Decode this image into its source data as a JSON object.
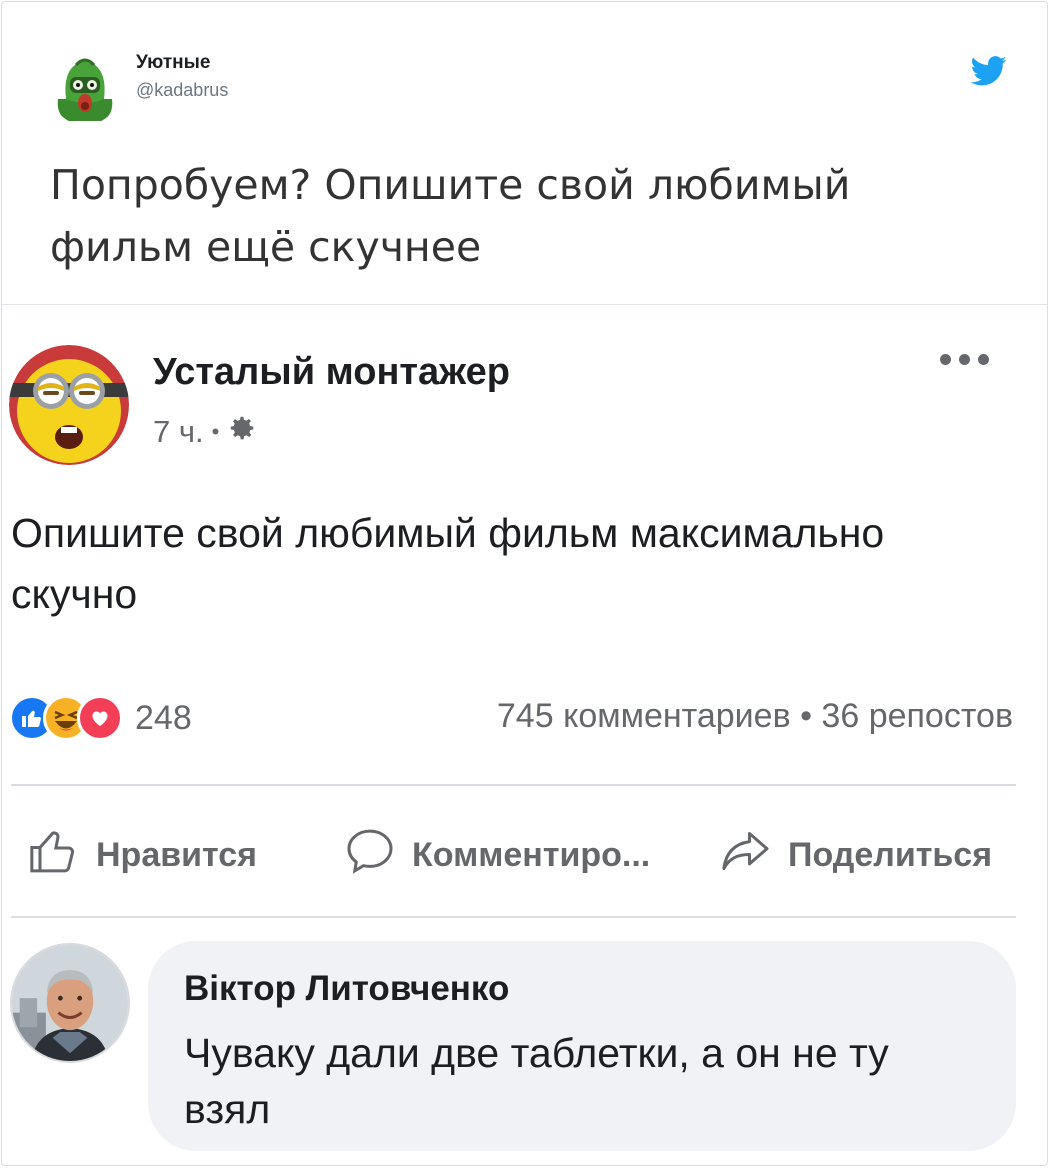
{
  "tweet": {
    "author_name": "Уютные",
    "author_handle": "@kadabrus",
    "text": "Попробуем? Опишите свой любимый фильм ещё скучнее",
    "icons": {
      "avatar": "avatar-character",
      "platform": "twitter-bird-icon"
    },
    "colors": {
      "bird": "#1da1f2",
      "text": "#333333",
      "handle": "#697882"
    }
  },
  "fb_post": {
    "author_name": "Усталый монтажер",
    "time": "7 ч.",
    "separator": "•",
    "privacy_icon": "gear-icon",
    "text": "Опишите свой любимый фильм максимально скучно",
    "reaction_icons": [
      "like-icon",
      "haha-icon",
      "love-icon"
    ],
    "reaction_count": "248",
    "stats": "745 комментариев • 36 репостов",
    "actions": {
      "like": "Нравится",
      "comment": "Комментиро...",
      "share": "Поделиться"
    },
    "comment": {
      "author": "Віктор Литовченко",
      "text": "Чуваку дали две таблетки, а он не ту взял"
    },
    "colors": {
      "like": "#1877f2",
      "love": "#f33e58",
      "haha": "#f7b125",
      "muted": "#65676b"
    }
  }
}
